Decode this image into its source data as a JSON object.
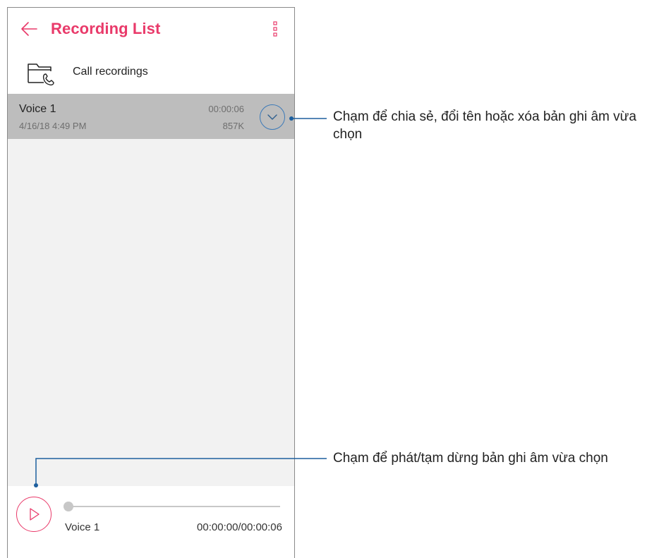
{
  "header": {
    "title": "Recording List",
    "back_icon": "arrow-left-icon",
    "menu_icon": "more-vertical-icon",
    "accent_color": "#e93a6a"
  },
  "folder": {
    "label": "Call recordings",
    "icon": "folder-phone-icon"
  },
  "recordings": [
    {
      "name": "Voice 1",
      "date": "4/16/18 4:49 PM",
      "duration": "00:00:06",
      "size": "857K",
      "selected": true
    }
  ],
  "player": {
    "track_name": "Voice 1",
    "time": "00:00:00/00:00:06",
    "progress": 0,
    "play_icon": "play-icon"
  },
  "callouts": {
    "expand": "Chạm để chia sẻ, đổi tên hoặc xóa bản ghi âm vừa chọn",
    "play": "Chạm để phát/tạm dừng bản ghi âm vừa chọn",
    "line_color": "#1d5f9e"
  }
}
